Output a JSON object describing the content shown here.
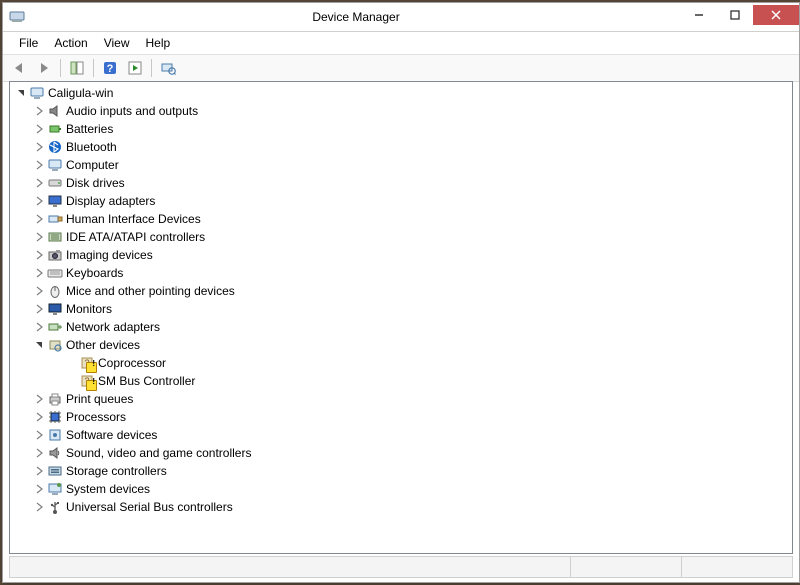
{
  "window": {
    "title": "Device Manager"
  },
  "menu": {
    "file": "File",
    "action": "Action",
    "view": "View",
    "help": "Help"
  },
  "toolbar_icons": {
    "back": "back-arrow-icon",
    "forward": "forward-arrow-icon",
    "show_hide": "show-hide-tree-icon",
    "help": "help-icon",
    "action": "action-pane-icon",
    "scan": "scan-hardware-icon"
  },
  "tree": {
    "root": {
      "label": "Caligula-win",
      "icon": "computer-icon",
      "expanded": true
    },
    "items": [
      {
        "label": "Audio inputs and outputs",
        "icon": "speaker-icon"
      },
      {
        "label": "Batteries",
        "icon": "battery-icon"
      },
      {
        "label": "Bluetooth",
        "icon": "bluetooth-icon"
      },
      {
        "label": "Computer",
        "icon": "computer-icon"
      },
      {
        "label": "Disk drives",
        "icon": "disk-drive-icon"
      },
      {
        "label": "Display adapters",
        "icon": "display-adapter-icon"
      },
      {
        "label": "Human Interface Devices",
        "icon": "hid-icon"
      },
      {
        "label": "IDE ATA/ATAPI controllers",
        "icon": "ide-controller-icon"
      },
      {
        "label": "Imaging devices",
        "icon": "camera-icon"
      },
      {
        "label": "Keyboards",
        "icon": "keyboard-icon"
      },
      {
        "label": "Mice and other pointing devices",
        "icon": "mouse-icon"
      },
      {
        "label": "Monitors",
        "icon": "monitor-icon"
      },
      {
        "label": "Network adapters",
        "icon": "network-adapter-icon"
      },
      {
        "label": "Other devices",
        "icon": "other-devices-icon",
        "expanded": true,
        "children": [
          {
            "label": "Coprocessor",
            "icon": "unknown-device-icon",
            "warning": true
          },
          {
            "label": "SM Bus Controller",
            "icon": "unknown-device-icon",
            "warning": true
          }
        ]
      },
      {
        "label": "Print queues",
        "icon": "printer-icon"
      },
      {
        "label": "Processors",
        "icon": "processor-icon"
      },
      {
        "label": "Software devices",
        "icon": "software-device-icon"
      },
      {
        "label": "Sound, video and game controllers",
        "icon": "sound-controller-icon"
      },
      {
        "label": "Storage controllers",
        "icon": "storage-controller-icon"
      },
      {
        "label": "System devices",
        "icon": "system-device-icon"
      },
      {
        "label": "Universal Serial Bus controllers",
        "icon": "usb-icon"
      }
    ]
  }
}
